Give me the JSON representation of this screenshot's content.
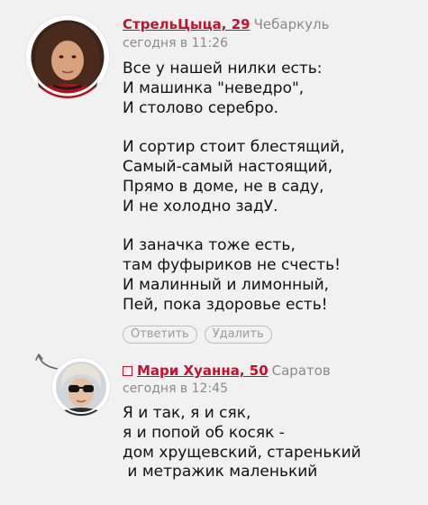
{
  "comments": [
    {
      "author": "СтрельЦыца, 29",
      "city": "Чебаркуль",
      "time": "сегодня в 11:26",
      "text": "Все у нашей нилки есть:\nИ машинка \"неведро\",\nИ столово серебро.\n\nИ сортир стоит блестящий,\nСамый-самый настоящий,\nПрямо в доме, не в саду,\nИ не холодно задУ.\n\nИ заначка тоже есть,\nтам фуфыриков не счесть!\nИ малинный и лимонный,\nПей, пока здоровье есть!",
      "reply_label": "Ответить",
      "delete_label": "Удалить"
    },
    {
      "author": "Мари Хуанна, 50",
      "city": "Саратов",
      "time": "сегодня в 12:45",
      "text": "Я и так, я и сяк,\nя и попой об косяк -\nдом хрущевский, старенький\n и метражик маленький"
    }
  ],
  "colors": {
    "background": "#f1f1f1",
    "author_link": "#c8102e",
    "muted": "#8a8a8a"
  },
  "icons": {
    "reply_indicator": "curved-arrow-icon",
    "author_badge": "square-icon"
  }
}
